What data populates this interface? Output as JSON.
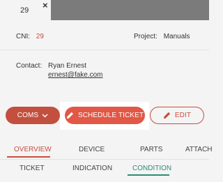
{
  "tab": {
    "label": "29",
    "close_glyph": "×"
  },
  "details": {
    "cni_label": "CNI:",
    "cni_value": "29",
    "project_label": "Project:",
    "project_value": "Manuals",
    "contact_label": "Contact:",
    "contact_name": "Ryan Ernest",
    "contact_email": "ernest@fake.com"
  },
  "actions": {
    "coms_label": "COMS",
    "coms_icon": "chevron-down-icon",
    "schedule_label": "SCHEDULE TICKET",
    "schedule_icon": "pencil-icon",
    "edit_label": "EDIT",
    "edit_icon": "pencil-icon"
  },
  "nav_main": [
    "OVERVIEW",
    "DEVICE",
    "PARTS",
    "ATTACH"
  ],
  "nav_sub": [
    "TICKET",
    "INDICATION",
    "CONDITION"
  ],
  "colors": {
    "accent_red": "#c84e3e",
    "schedule_red": "#e25745",
    "accent_teal": "#2f8a73",
    "topbar_gray": "#7b7b7b"
  }
}
